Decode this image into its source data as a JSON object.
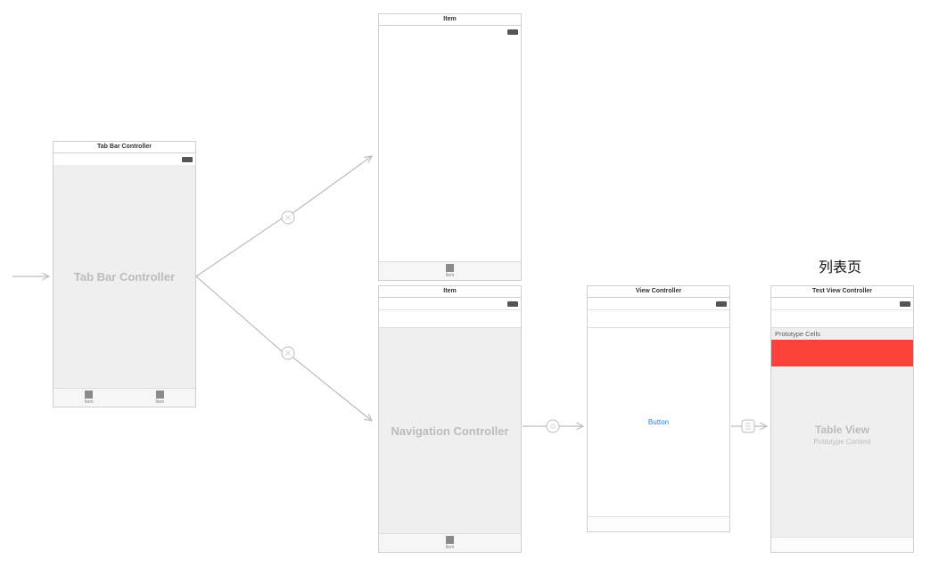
{
  "scenes": {
    "tabBarController": {
      "title": "Tab Bar Controller",
      "placeholder": "Tab Bar Controller",
      "tabs": [
        {
          "label": "Item"
        },
        {
          "label": "Item"
        }
      ]
    },
    "item1": {
      "title": "Item",
      "tab": {
        "label": "Item"
      }
    },
    "navigationController": {
      "title": "Item",
      "placeholder": "Navigation Controller",
      "tab": {
        "label": "Item"
      }
    },
    "viewController": {
      "title": "View Controller",
      "buttonLabel": "Button"
    },
    "testViewController": {
      "title": "Test View Controller",
      "prototypeLabel": "Prototype Cells",
      "tableViewTitle": "Table View",
      "tableViewSubtitle": "Prototype Content",
      "floating": "列表页"
    }
  },
  "colors": {
    "prototypeCell": "#f9423a",
    "link": "#1e7cff"
  }
}
